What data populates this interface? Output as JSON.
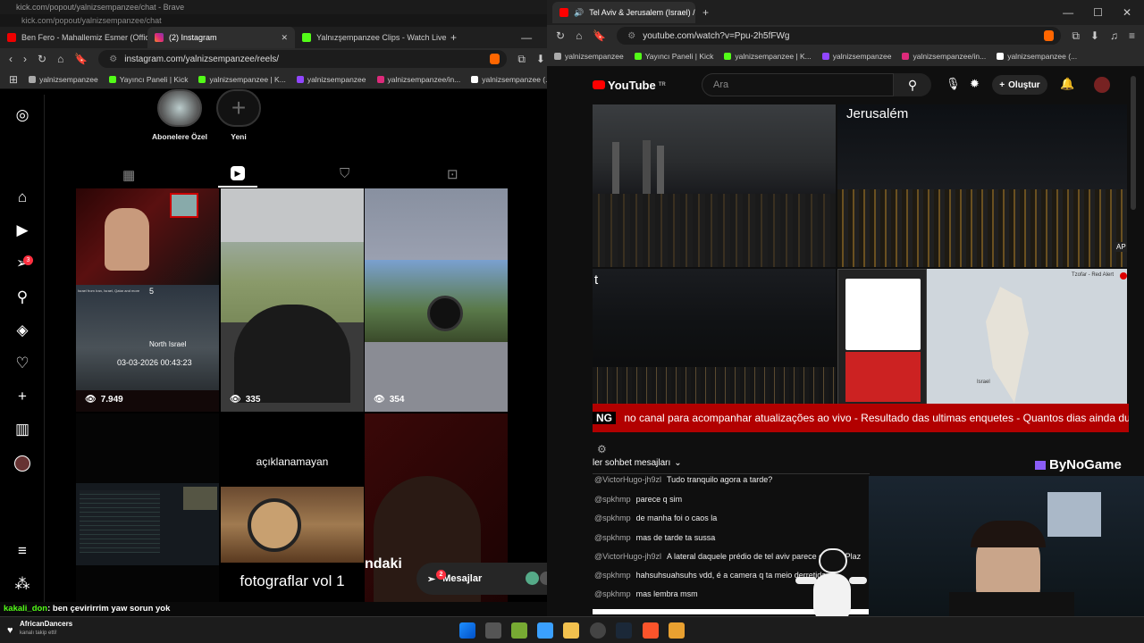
{
  "top_window_title": "kick.com/popout/yalnizsempanzee/chat - Brave",
  "top_window_url": "kick.com/popout/yalnizsempanzee/chat",
  "left_tabs": [
    {
      "label": "Ben Fero - Mahallemiz Esmer (Offici..."
    },
    {
      "label": "(2) Instagram"
    },
    {
      "label": "Yalnızşempanzee Clips - Watch Live ..."
    }
  ],
  "left_url": "instagram.com/yalnizsempanzee/reels/",
  "bookmarks": [
    {
      "label": "yalnizsempanzee"
    },
    {
      "label": "Yayıncı Paneli | Kick"
    },
    {
      "label": "yalnizsempanzee | K..."
    },
    {
      "label": "yalnizsempanzee"
    },
    {
      "label": "yalnizsempanzee/in..."
    },
    {
      "label": "yalnizsempanzee (..."
    }
  ],
  "highlights": [
    {
      "label": "Abonelere Özel"
    },
    {
      "label": "Yeni"
    }
  ],
  "ig_badge": "3",
  "reels": [
    {
      "views": "7.949",
      "overlay": "North Israel",
      "timestamp": "03-03-2026 00:43:23",
      "caption_top": "Israel from Iran, Israel, Qatar and more",
      "num": "5"
    },
    {
      "views": "335"
    },
    {
      "views": "354"
    },
    {
      "caption": "açıklanamayan"
    },
    {
      "caption": "fotograflar vol 1"
    },
    {
      "caption": "ndaki"
    }
  ],
  "messages_pill": {
    "label": "Mesajlar",
    "badge": "2"
  },
  "kick_chat": {
    "user": "kakali_don",
    "text": ": ben çevirirrim yaw sorun yok"
  },
  "notification": {
    "title": "AfricanDancers",
    "subtitle": "kanalı takip etti!"
  },
  "right_tab": {
    "label": "Tel Aviv & Jerusalem (Israel) /"
  },
  "right_url": "youtube.com/watch?v=Ppu-2h5fFWg",
  "right_bookmarks": [
    {
      "label": "yalnizsempanzee"
    },
    {
      "label": "Yayıncı Paneli | Kick"
    },
    {
      "label": "yalnizsempanzee | K..."
    },
    {
      "label": "yalnizsempanzee"
    },
    {
      "label": "yalnizsempanzee/in..."
    },
    {
      "label": "yalnizsempanzee (..."
    }
  ],
  "youtube": {
    "logo": "YouTube",
    "country": "TR",
    "search_placeholder": "Ara",
    "create_label": "Oluştur",
    "jerusalem_label": "Jerusalém",
    "ap_label": "AP",
    "t_label": "t",
    "alert_title": "Tzofar - Red Alert",
    "israel_label": "Israel",
    "ticker_tag": "NG",
    "ticker_text": "no canal para acompanhar atualizações ao vivo - Resultado das ultimas enquetes - Quantos dias ainda duram",
    "chat_mode": "ler sohbet mesajları",
    "watermark": "ByNoGame"
  },
  "yt_chat": [
    {
      "user": "@VictorHugo-jh9zl",
      "text": "Tudo tranquilo agora a tarde?"
    },
    {
      "user": "@spkhmp",
      "text": "parece q sim"
    },
    {
      "user": "@spkhmp",
      "text": "de manha foi o caos la"
    },
    {
      "user": "@spkhmp",
      "text": "mas de tarde ta sussa"
    },
    {
      "user": "@VictorHugo-jh9zl",
      "text": "A lateral daquele prédio de tel aviv parece c... ma Plaz"
    },
    {
      "user": "@spkhmp",
      "text": "hahsuhsuahsuhs vdd, é a camera q ta meio derretida"
    },
    {
      "user": "@spkhmp",
      "text": "mas lembra msm"
    }
  ],
  "colors": {
    "ig_accent": "#ff3040",
    "kick_green": "#53fc18",
    "yt_red": "#ff0000",
    "ticker_red": "#b20000"
  }
}
